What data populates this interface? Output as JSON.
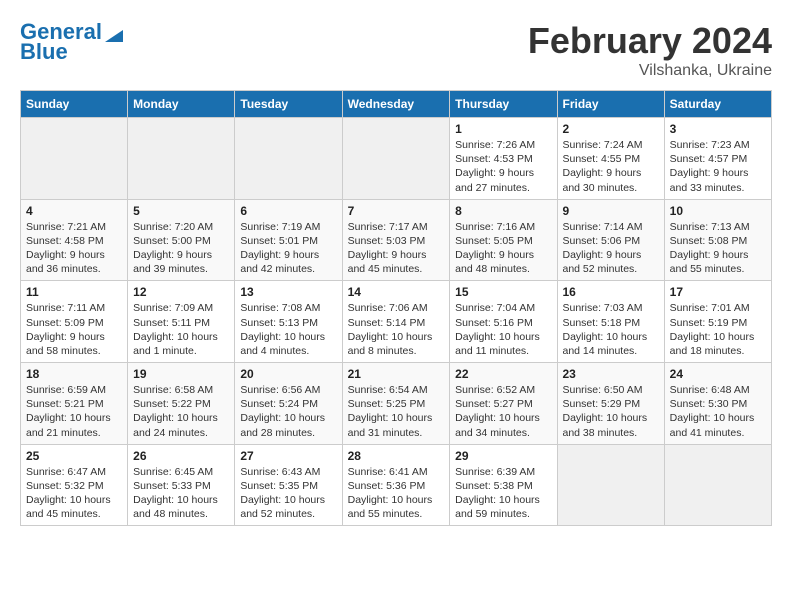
{
  "logo": {
    "line1": "General",
    "line2": "Blue"
  },
  "title": "February 2024",
  "subtitle": "Vilshanka, Ukraine",
  "columns": [
    "Sunday",
    "Monday",
    "Tuesday",
    "Wednesday",
    "Thursday",
    "Friday",
    "Saturday"
  ],
  "weeks": [
    [
      {
        "day": "",
        "info": ""
      },
      {
        "day": "",
        "info": ""
      },
      {
        "day": "",
        "info": ""
      },
      {
        "day": "",
        "info": ""
      },
      {
        "day": "1",
        "info": "Sunrise: 7:26 AM\nSunset: 4:53 PM\nDaylight: 9 hours\nand 27 minutes."
      },
      {
        "day": "2",
        "info": "Sunrise: 7:24 AM\nSunset: 4:55 PM\nDaylight: 9 hours\nand 30 minutes."
      },
      {
        "day": "3",
        "info": "Sunrise: 7:23 AM\nSunset: 4:57 PM\nDaylight: 9 hours\nand 33 minutes."
      }
    ],
    [
      {
        "day": "4",
        "info": "Sunrise: 7:21 AM\nSunset: 4:58 PM\nDaylight: 9 hours\nand 36 minutes."
      },
      {
        "day": "5",
        "info": "Sunrise: 7:20 AM\nSunset: 5:00 PM\nDaylight: 9 hours\nand 39 minutes."
      },
      {
        "day": "6",
        "info": "Sunrise: 7:19 AM\nSunset: 5:01 PM\nDaylight: 9 hours\nand 42 minutes."
      },
      {
        "day": "7",
        "info": "Sunrise: 7:17 AM\nSunset: 5:03 PM\nDaylight: 9 hours\nand 45 minutes."
      },
      {
        "day": "8",
        "info": "Sunrise: 7:16 AM\nSunset: 5:05 PM\nDaylight: 9 hours\nand 48 minutes."
      },
      {
        "day": "9",
        "info": "Sunrise: 7:14 AM\nSunset: 5:06 PM\nDaylight: 9 hours\nand 52 minutes."
      },
      {
        "day": "10",
        "info": "Sunrise: 7:13 AM\nSunset: 5:08 PM\nDaylight: 9 hours\nand 55 minutes."
      }
    ],
    [
      {
        "day": "11",
        "info": "Sunrise: 7:11 AM\nSunset: 5:09 PM\nDaylight: 9 hours\nand 58 minutes."
      },
      {
        "day": "12",
        "info": "Sunrise: 7:09 AM\nSunset: 5:11 PM\nDaylight: 10 hours\nand 1 minute."
      },
      {
        "day": "13",
        "info": "Sunrise: 7:08 AM\nSunset: 5:13 PM\nDaylight: 10 hours\nand 4 minutes."
      },
      {
        "day": "14",
        "info": "Sunrise: 7:06 AM\nSunset: 5:14 PM\nDaylight: 10 hours\nand 8 minutes."
      },
      {
        "day": "15",
        "info": "Sunrise: 7:04 AM\nSunset: 5:16 PM\nDaylight: 10 hours\nand 11 minutes."
      },
      {
        "day": "16",
        "info": "Sunrise: 7:03 AM\nSunset: 5:18 PM\nDaylight: 10 hours\nand 14 minutes."
      },
      {
        "day": "17",
        "info": "Sunrise: 7:01 AM\nSunset: 5:19 PM\nDaylight: 10 hours\nand 18 minutes."
      }
    ],
    [
      {
        "day": "18",
        "info": "Sunrise: 6:59 AM\nSunset: 5:21 PM\nDaylight: 10 hours\nand 21 minutes."
      },
      {
        "day": "19",
        "info": "Sunrise: 6:58 AM\nSunset: 5:22 PM\nDaylight: 10 hours\nand 24 minutes."
      },
      {
        "day": "20",
        "info": "Sunrise: 6:56 AM\nSunset: 5:24 PM\nDaylight: 10 hours\nand 28 minutes."
      },
      {
        "day": "21",
        "info": "Sunrise: 6:54 AM\nSunset: 5:25 PM\nDaylight: 10 hours\nand 31 minutes."
      },
      {
        "day": "22",
        "info": "Sunrise: 6:52 AM\nSunset: 5:27 PM\nDaylight: 10 hours\nand 34 minutes."
      },
      {
        "day": "23",
        "info": "Sunrise: 6:50 AM\nSunset: 5:29 PM\nDaylight: 10 hours\nand 38 minutes."
      },
      {
        "day": "24",
        "info": "Sunrise: 6:48 AM\nSunset: 5:30 PM\nDaylight: 10 hours\nand 41 minutes."
      }
    ],
    [
      {
        "day": "25",
        "info": "Sunrise: 6:47 AM\nSunset: 5:32 PM\nDaylight: 10 hours\nand 45 minutes."
      },
      {
        "day": "26",
        "info": "Sunrise: 6:45 AM\nSunset: 5:33 PM\nDaylight: 10 hours\nand 48 minutes."
      },
      {
        "day": "27",
        "info": "Sunrise: 6:43 AM\nSunset: 5:35 PM\nDaylight: 10 hours\nand 52 minutes."
      },
      {
        "day": "28",
        "info": "Sunrise: 6:41 AM\nSunset: 5:36 PM\nDaylight: 10 hours\nand 55 minutes."
      },
      {
        "day": "29",
        "info": "Sunrise: 6:39 AM\nSunset: 5:38 PM\nDaylight: 10 hours\nand 59 minutes."
      },
      {
        "day": "",
        "info": ""
      },
      {
        "day": "",
        "info": ""
      }
    ]
  ]
}
